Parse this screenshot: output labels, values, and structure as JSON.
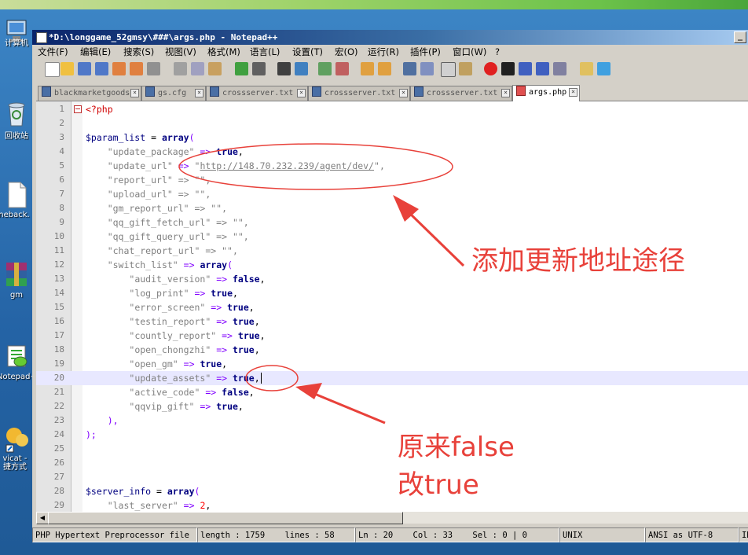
{
  "desktop": {
    "top_title": "",
    "icons": [
      "计算机",
      "回收站",
      "neback.",
      "gm",
      "Notepad+",
      "vicat -\n捷方式"
    ]
  },
  "window": {
    "title": "*D:\\longgame_52gmsy\\###\\args.php - Notepad++",
    "menu": [
      "文件(F)",
      "编辑(E)",
      "搜索(S)",
      "视图(V)",
      "格式(M)",
      "语言(L)",
      "设置(T)",
      "宏(O)",
      "运行(R)",
      "插件(P)",
      "窗口(W)",
      "?"
    ],
    "tabs": [
      {
        "label": "blackmarketgoods",
        "active": false
      },
      {
        "label": "gs.cfg",
        "active": false
      },
      {
        "label": "crossserver.txt",
        "active": false
      },
      {
        "label": "crossserver.txt",
        "active": false
      },
      {
        "label": "crossserver.txt",
        "active": false
      },
      {
        "label": "args.php",
        "active": true
      }
    ],
    "line_numbers": [
      "1",
      "2",
      "3",
      "4",
      "5",
      "6",
      "7",
      "8",
      "9",
      "10",
      "11",
      "12",
      "13",
      "14",
      "15",
      "16",
      "17",
      "18",
      "19",
      "20",
      "21",
      "22",
      "23",
      "24",
      "25",
      "26",
      "27",
      "28",
      "29"
    ],
    "code": {
      "l1": "<?php",
      "l3_var": "$param_list",
      "l3_rest": " = ",
      "l3_kw": "array",
      "l3_end": "(",
      "l4_key": "\"update_package\"",
      "l4_val": "true",
      "l5_key": "\"update_url\"",
      "l5_q1": "\"",
      "l5_url": "http://148.70.232.239/agent/dev/",
      "l5_q2": "\",",
      "l6": "\"report_url\" => \"\",",
      "l7": "\"upload_url\" => \"\",",
      "l8": "\"gm_report_url\" => \"\",",
      "l9": "\"qq_gift_fetch_url\" => \"\",",
      "l10": "\"qq_gift_query_url\" => \"\",",
      "l11": "\"chat_report_url\" => \"\",",
      "l12_key": "\"switch_list\"",
      "l12_kw": "array",
      "l13_key": "\"audit_version\"",
      "l13_val": "false",
      "l14_key": "\"log_print\"",
      "l14_val": "true",
      "l15_key": "\"error_screen\"",
      "l15_val": "true",
      "l16_key": "\"testin_report\"",
      "l16_val": "true",
      "l17_key": "\"countly_report\"",
      "l17_val": "true",
      "l18_key": "\"open_chongzhi\"",
      "l18_val": "true",
      "l19_key": "\"open_gm\"",
      "l19_val": "true",
      "l20_key": "\"update_assets\"",
      "l20_val": "true",
      "l21_key": "\"active_code\"",
      "l21_val": "false",
      "l22_key": "\"qqvip_gift\"",
      "l22_val": "true",
      "l23": "),",
      "l24": ");",
      "l28_var": "$server_info",
      "l28_kw": "array",
      "l29_key": "\"last_server\"",
      "l29_val": "2"
    },
    "status": {
      "filetype": "PHP Hypertext Preprocessor file",
      "length": "length : 1759    lines : 58",
      "position": "Ln : 20    Col : 33    Sel : 0 | 0",
      "eol": "UNIX",
      "encoding": "ANSI as UTF-8",
      "ins": "IN"
    }
  },
  "annotations": {
    "note1": "添加更新地址途径",
    "note2_line1": "原来false",
    "note2_line2": "改true",
    "color": "#e8413a"
  }
}
